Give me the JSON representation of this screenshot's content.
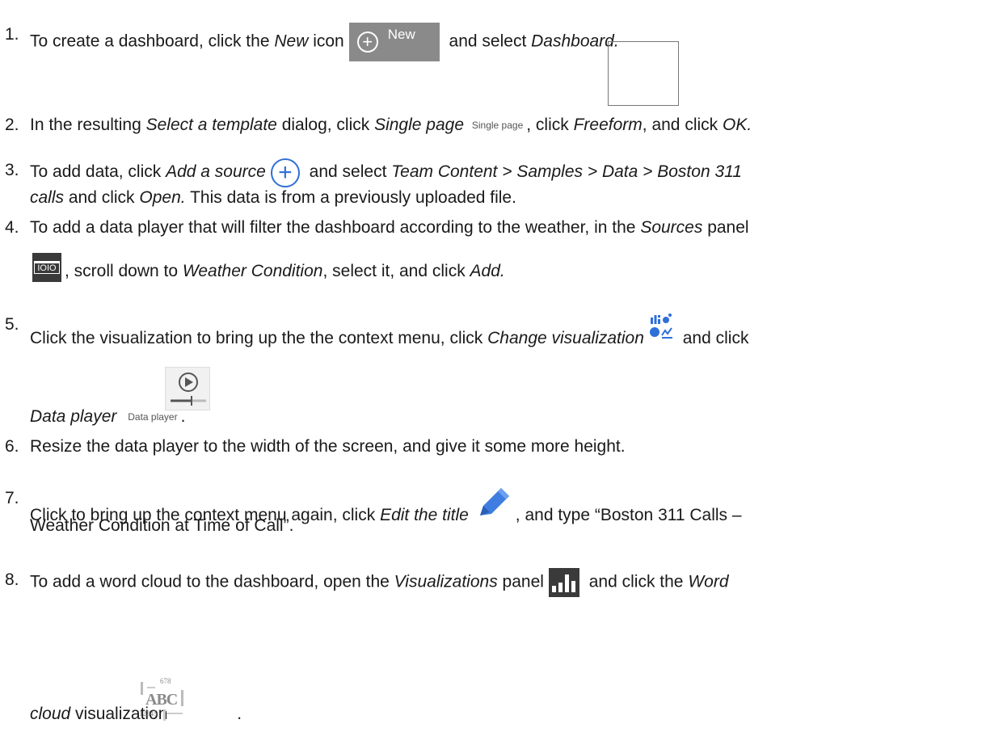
{
  "steps": [
    {
      "num": "1.",
      "pre": "To create a dashboard, click the ",
      "em1": "New",
      "mid1": " icon",
      "btn_label": "New",
      "post": " and select ",
      "em2": "Dashboard."
    },
    {
      "num": "2.",
      "pre": "In the resulting ",
      "em1": "Select a template",
      "mid1": " dialog, click ",
      "em2": "Single page",
      "caption": "Single page",
      "mid2": ", click ",
      "em3": "Freeform",
      "mid3": ", and click ",
      "em4": "OK."
    },
    {
      "num": "3.",
      "pre": "To add data, click ",
      "em1": "Add a source",
      "mid1": " and select ",
      "em2": "Team Content > Samples > Data > Boston 311",
      "line2_em": "calls",
      "line2_mid": " and click ",
      "line2_em2": "Open.",
      "line2_post": " This data is from a previously uploaded file."
    },
    {
      "num": "4.",
      "pre": "To add a data player that will filter the dashboard according to the weather, in the ",
      "em1": "Sources",
      "post": " panel",
      "icon_text": "IOIO",
      "line2_pre": ", scroll down to ",
      "line2_em": "Weather Condition",
      "line2_mid": ", select it, and click ",
      "line2_em2": "Add."
    },
    {
      "num": "5.",
      "pre": "Click the visualization to bring up the the context menu, click ",
      "em1": "Change visualization",
      "post": " and click",
      "line2_em": "Data player",
      "caption": "Data player",
      "line2_post": "."
    },
    {
      "num": "6.",
      "text": "Resize the data player to the width of the screen, and give it some more height."
    },
    {
      "num": "7.",
      "pre": "Click to bring up the context menu again, click ",
      "em1": "Edit the title",
      "post": ", and type “Boston 311 Calls –",
      "line2": "Weather Condition at Time of Call”."
    },
    {
      "num": "8.",
      "pre": "To add a word cloud to the dashboard, open the ",
      "em1": "Visualizations",
      "mid1": " panel",
      "post": " and click the ",
      "em2": "Word",
      "line2_em": "cloud",
      "line2_post": " visualization",
      "line2_end": "."
    }
  ],
  "wordcloud_icon": {
    "n1": "678",
    "word": "ABC",
    "n2": "12345"
  },
  "colors": {
    "accent_blue": "#2f6fd9",
    "dark_icon": "#3a3a3a",
    "new_button": "#8a8a8a"
  }
}
